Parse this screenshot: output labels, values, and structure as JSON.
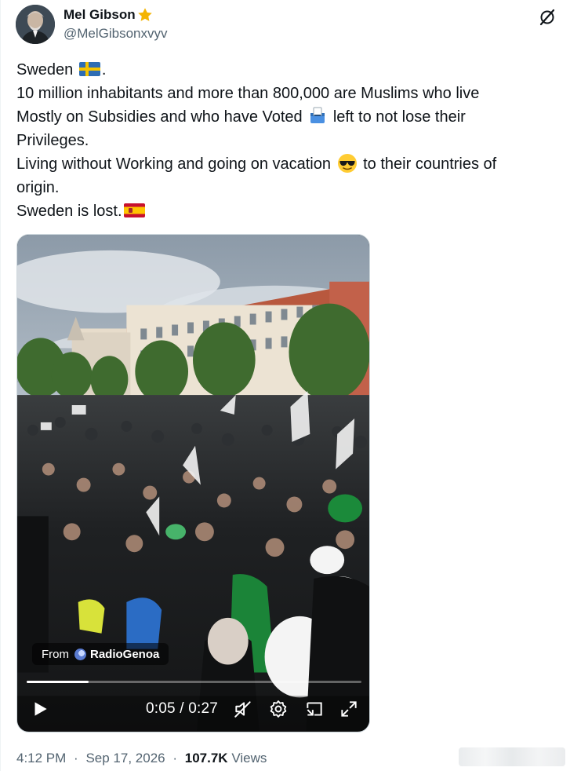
{
  "author": {
    "display_name": "Mel Gibson",
    "handle": "@MelGibsonxvyv",
    "badge_icon": "gold-star-icon"
  },
  "header_icons": {
    "grok": "grok-slash-circle-icon"
  },
  "tweet": {
    "lines": [
      "Sweden",
      ".",
      "10 million inhabitants and more than 800,000 are Muslims who live",
      "Mostly on Subsidies and who have Voted",
      "left to not lose their",
      "Privileges.",
      "Living without Working and going on vacation",
      "to their countries of",
      "origin.",
      "Sweden is lost."
    ],
    "emojis": [
      "sweden-flag-icon",
      "ballot-box-icon",
      "sunglasses-face-icon",
      "spain-flag-icon"
    ]
  },
  "media": {
    "type": "video",
    "source_prefix": "From",
    "source_name": "RadioGenoa",
    "current_time": "0:05",
    "separator": "/",
    "duration": "0:27",
    "progress_fraction": 0.185,
    "controls": [
      "play-icon",
      "mute-icon",
      "settings-gear-icon",
      "pip-icon",
      "fullscreen-icon"
    ]
  },
  "meta": {
    "time": "4:12 PM",
    "dot": "·",
    "date": "Sep 17, 2026",
    "dot2": "·",
    "views_count": "107.7K",
    "views_label": "Views"
  },
  "colors": {
    "text": "#0f1419",
    "secondary": "#536471",
    "border": "#cfd9de",
    "star": "#f4b400"
  }
}
